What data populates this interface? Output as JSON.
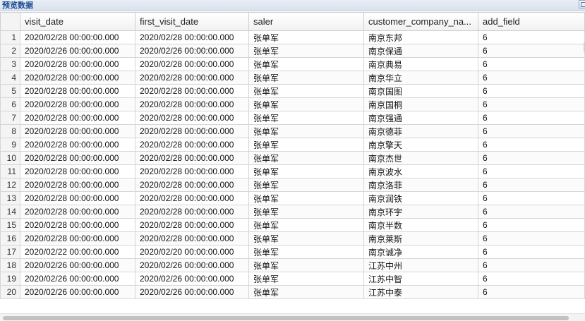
{
  "panel": {
    "title": "预览数据"
  },
  "table": {
    "columns": [
      "visit_date",
      "first_visit_date",
      "saler",
      "customer_company_na...",
      "add_field"
    ],
    "rows": [
      {
        "n": "1",
        "visit_date": "2020/02/28 00:00:00.000",
        "first_visit_date": "2020/02/28 00:00:00.000",
        "saler": "张单军",
        "company": "南京东邦",
        "add_field": "6"
      },
      {
        "n": "2",
        "visit_date": "2020/02/26 00:00:00.000",
        "first_visit_date": "2020/02/26 00:00:00.000",
        "saler": "张单军",
        "company": "南京保通",
        "add_field": "6"
      },
      {
        "n": "3",
        "visit_date": "2020/02/28 00:00:00.000",
        "first_visit_date": "2020/02/28 00:00:00.000",
        "saler": "张单军",
        "company": "南京典易",
        "add_field": "6"
      },
      {
        "n": "4",
        "visit_date": "2020/02/28 00:00:00.000",
        "first_visit_date": "2020/02/28 00:00:00.000",
        "saler": "张单军",
        "company": "南京华立",
        "add_field": "6"
      },
      {
        "n": "5",
        "visit_date": "2020/02/28 00:00:00.000",
        "first_visit_date": "2020/02/28 00:00:00.000",
        "saler": "张单军",
        "company": "南京国图",
        "add_field": "6"
      },
      {
        "n": "6",
        "visit_date": "2020/02/28 00:00:00.000",
        "first_visit_date": "2020/02/28 00:00:00.000",
        "saler": "张单军",
        "company": "南京国桐",
        "add_field": "6"
      },
      {
        "n": "7",
        "visit_date": "2020/02/28 00:00:00.000",
        "first_visit_date": "2020/02/28 00:00:00.000",
        "saler": "张单军",
        "company": "南京强通",
        "add_field": "6"
      },
      {
        "n": "8",
        "visit_date": "2020/02/28 00:00:00.000",
        "first_visit_date": "2020/02/28 00:00:00.000",
        "saler": "张单军",
        "company": "南京德菲",
        "add_field": "6"
      },
      {
        "n": "9",
        "visit_date": "2020/02/28 00:00:00.000",
        "first_visit_date": "2020/02/28 00:00:00.000",
        "saler": "张单军",
        "company": "南京擎天",
        "add_field": "6"
      },
      {
        "n": "10",
        "visit_date": "2020/02/28 00:00:00.000",
        "first_visit_date": "2020/02/28 00:00:00.000",
        "saler": "张单军",
        "company": "南京杰世",
        "add_field": "6"
      },
      {
        "n": "11",
        "visit_date": "2020/02/28 00:00:00.000",
        "first_visit_date": "2020/02/28 00:00:00.000",
        "saler": "张单军",
        "company": "南京波水",
        "add_field": "6"
      },
      {
        "n": "12",
        "visit_date": "2020/02/28 00:00:00.000",
        "first_visit_date": "2020/02/28 00:00:00.000",
        "saler": "张单军",
        "company": "南京洛菲",
        "add_field": "6"
      },
      {
        "n": "13",
        "visit_date": "2020/02/28 00:00:00.000",
        "first_visit_date": "2020/02/28 00:00:00.000",
        "saler": "张单军",
        "company": "南京润铁",
        "add_field": "6"
      },
      {
        "n": "14",
        "visit_date": "2020/02/28 00:00:00.000",
        "first_visit_date": "2020/02/28 00:00:00.000",
        "saler": "张单军",
        "company": "南京环宇",
        "add_field": "6"
      },
      {
        "n": "15",
        "visit_date": "2020/02/28 00:00:00.000",
        "first_visit_date": "2020/02/28 00:00:00.000",
        "saler": "张单军",
        "company": "南京半数",
        "add_field": "6"
      },
      {
        "n": "16",
        "visit_date": "2020/02/28 00:00:00.000",
        "first_visit_date": "2020/02/28 00:00:00.000",
        "saler": "张单军",
        "company": "南京莱斯",
        "add_field": "6"
      },
      {
        "n": "17",
        "visit_date": "2020/02/22 00:00:00.000",
        "first_visit_date": "2020/02/20 00:00:00.000",
        "saler": "张单军",
        "company": "南京诚净",
        "add_field": "6"
      },
      {
        "n": "18",
        "visit_date": "2020/02/26 00:00:00.000",
        "first_visit_date": "2020/02/26 00:00:00.000",
        "saler": "张单军",
        "company": "江苏中州",
        "add_field": "6"
      },
      {
        "n": "19",
        "visit_date": "2020/02/26 00:00:00.000",
        "first_visit_date": "2020/02/26 00:00:00.000",
        "saler": "张单军",
        "company": "江苏中智",
        "add_field": "6"
      },
      {
        "n": "20",
        "visit_date": "2020/02/26 00:00:00.000",
        "first_visit_date": "2020/02/26 00:00:00.000",
        "saler": "张单军",
        "company": "江苏中泰",
        "add_field": "6"
      }
    ]
  },
  "colors": {
    "title_text": "#1c4a93",
    "grid_border": "#d6d6d6",
    "rownum_bg": "#f4f4f4"
  },
  "icons": {
    "panel_button": "restore-icon"
  }
}
